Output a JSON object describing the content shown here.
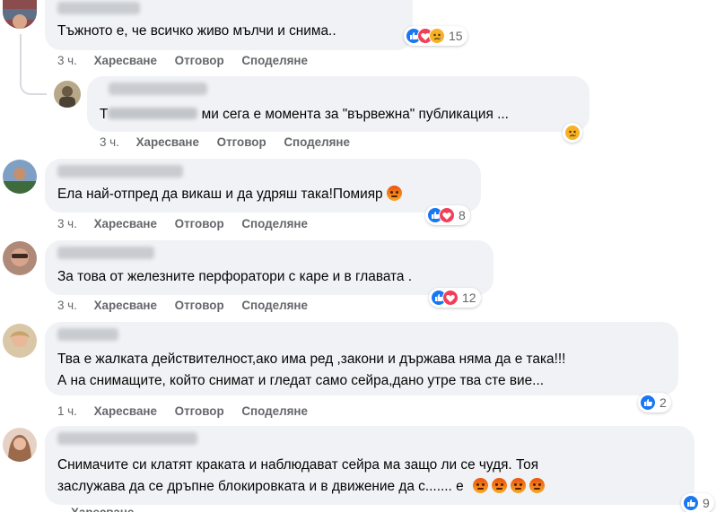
{
  "comments": [
    {
      "id": "c1",
      "text": "Тъжното е, че всичко живо мълчи и снима..",
      "reaction_types": [
        "like-icon",
        "love-icon",
        "sad-icon"
      ],
      "reaction_count": "15",
      "time": "3 ч."
    },
    {
      "id": "c2",
      "text_prefix": "Т",
      "text_suffix": " ми сега е момента за \"вървежна\" публикация ...",
      "reaction_types": [
        "sad-icon"
      ],
      "reaction_count": "",
      "time": "3 ч."
    },
    {
      "id": "c3",
      "text": "Ела най-отпред да викаш и да удряш така!Помияр",
      "reaction_types": [
        "like-icon",
        "love-icon"
      ],
      "reaction_count": "8",
      "time": "3 ч."
    },
    {
      "id": "c4",
      "text": "За това от железните перфоратори с каре и в главата .",
      "reaction_types": [
        "like-icon",
        "love-icon"
      ],
      "reaction_count": "12",
      "time": "3 ч."
    },
    {
      "id": "c5",
      "text_line1": "Тва е жалката действителност,ако има ред ,закони и държава няма да е така!!!",
      "text_line2": "А на снимащите, който снимат и гледат само сейра,дано утре тва сте вие...",
      "reaction_types": [
        "like-icon"
      ],
      "reaction_count": "2",
      "time": "1 ч."
    },
    {
      "id": "c6",
      "text_line1": "Снимачите си клатят краката и наблюдават сейра ма защо ли се чудя. Тоя",
      "text_line2": "заслужава да се дръпне блокировката и в движение да с....... е",
      "reaction_types": [
        "like-icon"
      ],
      "reaction_count": "9",
      "time": ""
    }
  ],
  "actions": {
    "like": "Харесване",
    "reply": "Отговор",
    "share": "Споделяне"
  },
  "colors": {
    "bubble": "#f0f2f5",
    "meta_text": "#65676b",
    "like": "#1877f2",
    "love": "#f33e58",
    "sad": "#f7b125",
    "angry": "#e9710f"
  }
}
